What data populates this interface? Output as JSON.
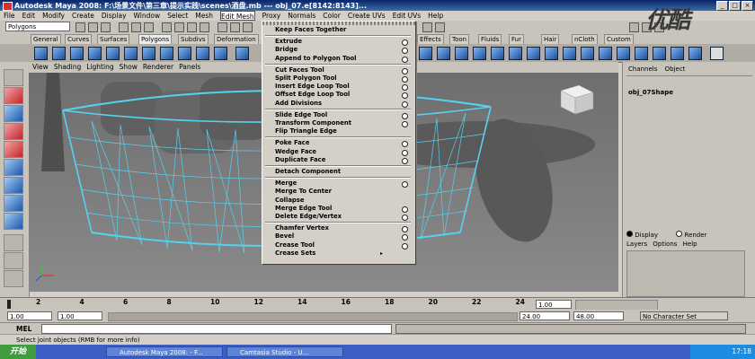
{
  "window": {
    "title": "Autodesk Maya 2008: F:\\场景文件\\第三章\\提示实践\\scenes\\酒盘.mb   ---   obj_07.e[8142:8143]...",
    "buttons": [
      "_",
      "□",
      "×"
    ]
  },
  "menubar": [
    "File",
    "Edit",
    "Modify",
    "Create",
    "Display",
    "Window",
    "Select",
    "Mesh",
    "Edit Mesh",
    "Proxy",
    "Normals",
    "Color",
    "Create UVs",
    "Edit UVs",
    "Help"
  ],
  "status_line": {
    "mode": "Polygons"
  },
  "shelf_tabs": [
    "General",
    "Curves",
    "Surfaces",
    "Polygons",
    "Subdivs",
    "Deformation",
    "Effects",
    "Toon",
    "Fluids",
    "Fur",
    "Hair",
    "nCloth",
    "Custom"
  ],
  "panel_menu": [
    "View",
    "Shading",
    "Lighting",
    "Show",
    "Renderer",
    "Panels"
  ],
  "edit_mesh_menu": [
    {
      "label": "Keep Faces Together",
      "option": false
    },
    {
      "separator": true
    },
    {
      "label": "Extrude",
      "option": true
    },
    {
      "label": "Bridge",
      "option": true
    },
    {
      "label": "Append to Polygon Tool",
      "option": true
    },
    {
      "separator": true
    },
    {
      "label": "Cut Faces Tool",
      "option": true
    },
    {
      "label": "Split Polygon Tool",
      "option": true
    },
    {
      "label": "Insert Edge Loop Tool",
      "option": true
    },
    {
      "label": "Offset Edge Loop Tool",
      "option": true
    },
    {
      "label": "Add Divisions",
      "option": true
    },
    {
      "separator": true
    },
    {
      "label": "Slide Edge Tool",
      "option": true
    },
    {
      "label": "Transform Component",
      "option": true
    },
    {
      "label": "Flip Triangle Edge",
      "option": false
    },
    {
      "separator": true
    },
    {
      "label": "Poke Face",
      "option": true
    },
    {
      "label": "Wedge Face",
      "option": true
    },
    {
      "label": "Duplicate Face",
      "option": true
    },
    {
      "separator": true
    },
    {
      "label": "Detach Component",
      "option": false
    },
    {
      "separator": true
    },
    {
      "label": "Merge",
      "option": true
    },
    {
      "label": "Merge To Center",
      "option": false
    },
    {
      "label": "Collapse",
      "option": false
    },
    {
      "label": "Merge Edge Tool",
      "option": true
    },
    {
      "label": "Delete Edge/Vertex",
      "option": true
    },
    {
      "separator": true
    },
    {
      "label": "Chamfer Vertex",
      "option": true
    },
    {
      "label": "Bevel",
      "option": true
    },
    {
      "label": "Crease Tool",
      "option": true
    },
    {
      "label": "Crease Sets",
      "submenu": true
    }
  ],
  "channel_box": {
    "header": [
      "Channels",
      "Object"
    ],
    "object": "obj_07Shape",
    "layer_tabs": [
      "Display",
      "Render"
    ],
    "layer_menu": [
      "Layers",
      "Options",
      "Help"
    ]
  },
  "time_slider": {
    "ticks": [
      "2",
      "4",
      "6",
      "8",
      "10",
      "12",
      "14",
      "16",
      "18",
      "20",
      "22",
      "24"
    ],
    "current": "1.00"
  },
  "range": {
    "start": "1.00",
    "inner_start": "1.00",
    "inner_end": "24.00",
    "end": "48.00",
    "char_set": "No Character Set"
  },
  "command_line": {
    "label": "MEL"
  },
  "help_line": {
    "text": "Select joint objects (RMB for more info)"
  },
  "taskbar": {
    "start": "开始",
    "tasks": [
      "Autodesk Maya 2008: - F...",
      "Camtasia Studio - U..."
    ],
    "clock": "17:18"
  },
  "watermark": "优酷"
}
